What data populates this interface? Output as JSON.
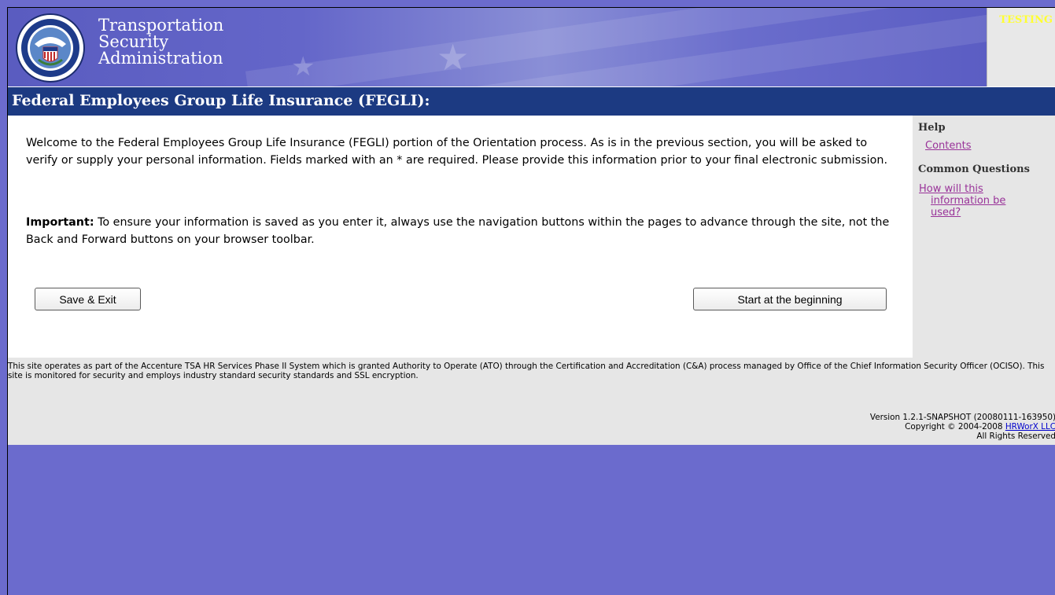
{
  "header": {
    "agency_line1": "Transportation",
    "agency_line2": "Security",
    "agency_line3": "Administration",
    "seal_text": "U.S. DEPARTMENT OF HOMELAND SECURITY",
    "environment_badge": "TESTING"
  },
  "page": {
    "title": "Federal Employees Group Life Insurance (FEGLI):"
  },
  "main": {
    "intro_text": "Welcome to the Federal Employees Group Life Insurance (FEGLI) portion of the Orientation process. As is in the previous section, you will be asked to verify or supply your personal information. Fields marked with an * are required. Please provide this information prior to your final electronic submission.",
    "important_label": "Important:",
    "important_text": " To ensure your information is saved as you enter it, always use the navigation buttons within the pages to advance through the site, not the Back and Forward buttons on your browser toolbar.",
    "save_exit_label": "Save & Exit",
    "start_label": "Start at the beginning"
  },
  "sidebar": {
    "help_heading": "Help",
    "contents_link": "Contents",
    "common_questions_heading": "Common Questions",
    "question_link_line1": "How will this",
    "question_link_line2": "information be",
    "question_link_line3": "used?"
  },
  "footer": {
    "notice": "This site operates as part of the Accenture TSA HR Services Phase II System which is granted Authority to Operate (ATO) through the Certification and Accreditation (C&A) process managed by Office of the Chief Information Security Officer (OCISO). This site is monitored for security and employs industry standard security standards and SSL encryption.",
    "version": "Version 1.2.1-SNAPSHOT (20080111-163950)",
    "copyright_prefix": "Copyright © 2004-2008 ",
    "copyright_link": "HRWorX LLC",
    "rights": "All Rights Reserved"
  },
  "colors": {
    "page_background": "#6b6bcd",
    "title_bar": "#1c3a82",
    "sidebar_background": "#e6e6e6",
    "visited_link": "#993399",
    "footer_link": "#0000cc",
    "testing_badge": "#ffff33"
  },
  "icons": {
    "seal": "dhs-seal-icon"
  }
}
